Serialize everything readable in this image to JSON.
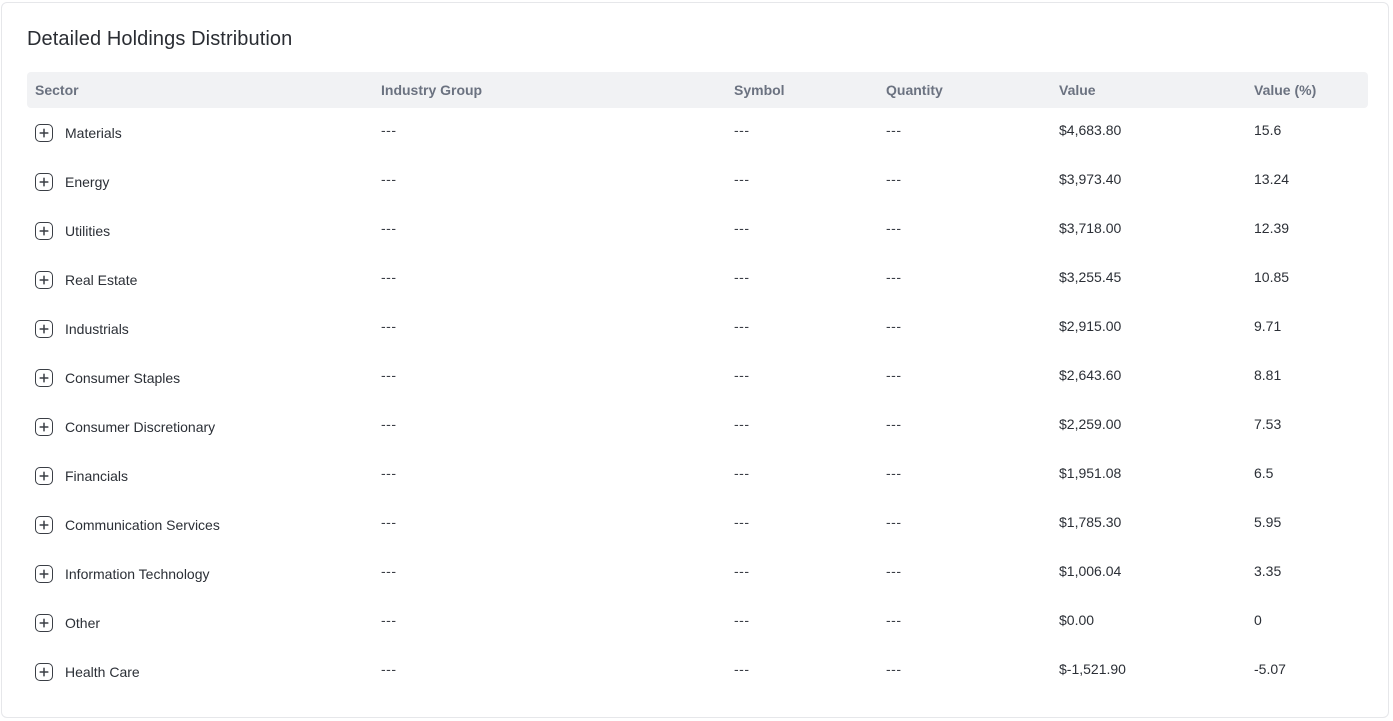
{
  "card": {
    "title": "Detailed Holdings Distribution"
  },
  "table": {
    "columns": {
      "sector": "Sector",
      "industry_group": "Industry Group",
      "symbol": "Symbol",
      "quantity": "Quantity",
      "value": "Value",
      "value_pct": "Value (%)"
    },
    "rows": [
      {
        "sector": "Materials",
        "industry_group": "---",
        "symbol": "---",
        "quantity": "---",
        "value": "$4,683.80",
        "value_pct": "15.6"
      },
      {
        "sector": "Energy",
        "industry_group": "---",
        "symbol": "---",
        "quantity": "---",
        "value": "$3,973.40",
        "value_pct": "13.24"
      },
      {
        "sector": "Utilities",
        "industry_group": "---",
        "symbol": "---",
        "quantity": "---",
        "value": "$3,718.00",
        "value_pct": "12.39"
      },
      {
        "sector": "Real Estate",
        "industry_group": "---",
        "symbol": "---",
        "quantity": "---",
        "value": "$3,255.45",
        "value_pct": "10.85"
      },
      {
        "sector": "Industrials",
        "industry_group": "---",
        "symbol": "---",
        "quantity": "---",
        "value": "$2,915.00",
        "value_pct": "9.71"
      },
      {
        "sector": "Consumer Staples",
        "industry_group": "---",
        "symbol": "---",
        "quantity": "---",
        "value": "$2,643.60",
        "value_pct": "8.81"
      },
      {
        "sector": "Consumer Discretionary",
        "industry_group": "---",
        "symbol": "---",
        "quantity": "---",
        "value": "$2,259.00",
        "value_pct": "7.53"
      },
      {
        "sector": "Financials",
        "industry_group": "---",
        "symbol": "---",
        "quantity": "---",
        "value": "$1,951.08",
        "value_pct": "6.5"
      },
      {
        "sector": "Communication Services",
        "industry_group": "---",
        "symbol": "---",
        "quantity": "---",
        "value": "$1,785.30",
        "value_pct": "5.95"
      },
      {
        "sector": "Information Technology",
        "industry_group": "---",
        "symbol": "---",
        "quantity": "---",
        "value": "$1,006.04",
        "value_pct": "3.35"
      },
      {
        "sector": "Other",
        "industry_group": "---",
        "symbol": "---",
        "quantity": "---",
        "value": "$0.00",
        "value_pct": "0"
      },
      {
        "sector": "Health Care",
        "industry_group": "---",
        "symbol": "---",
        "quantity": "---",
        "value": "$-1,521.90",
        "value_pct": "-5.07"
      }
    ]
  },
  "icons": {
    "expand": "plus-square-icon"
  }
}
